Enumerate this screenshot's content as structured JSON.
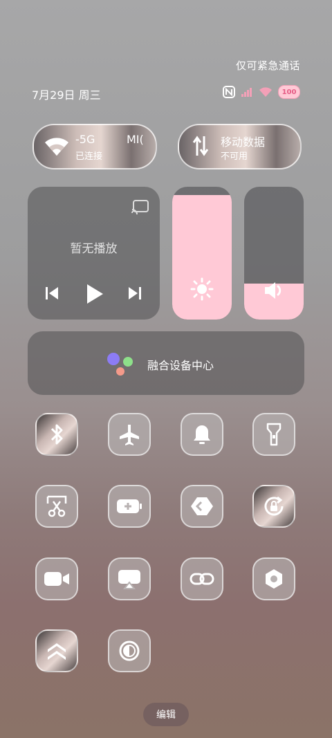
{
  "status": {
    "emergency": "仅可紧急通话",
    "date": "7月29日 周三",
    "battery": "100",
    "icons": [
      "nfc-icon",
      "signal-icon",
      "wifi-icon",
      "battery-icon"
    ]
  },
  "wifi_pill": {
    "name": "-5G",
    "suffix": "MI(",
    "state": "已连接"
  },
  "data_pill": {
    "name": "移动数据",
    "state": "不可用"
  },
  "media": {
    "title": "暂无播放"
  },
  "sliders": {
    "brightness_level": 0.94,
    "volume_level": 0.27
  },
  "hub": {
    "label": "融合设备中心"
  },
  "toggles": [
    {
      "name": "bluetooth",
      "icon": "bluetooth-icon"
    },
    {
      "name": "airplane-mode",
      "icon": "airplane-icon"
    },
    {
      "name": "ring-mode",
      "icon": "bell-icon"
    },
    {
      "name": "flashlight",
      "icon": "flashlight-icon"
    },
    {
      "name": "screenshot",
      "icon": "scissors-icon"
    },
    {
      "name": "battery-saver",
      "icon": "battery-plus-icon"
    },
    {
      "name": "cast",
      "icon": "share-icon"
    },
    {
      "name": "auto-rotate",
      "icon": "rotate-lock-icon"
    },
    {
      "name": "screen-record",
      "icon": "video-icon"
    },
    {
      "name": "screen-mirror",
      "icon": "airplay-icon"
    },
    {
      "name": "link",
      "icon": "link-icon"
    },
    {
      "name": "settings",
      "icon": "hex-gear-icon"
    },
    {
      "name": "performance-mode",
      "icon": "double-chevron-up-icon"
    },
    {
      "name": "dark-mode",
      "icon": "contrast-icon"
    }
  ],
  "edit_label": "编辑"
}
